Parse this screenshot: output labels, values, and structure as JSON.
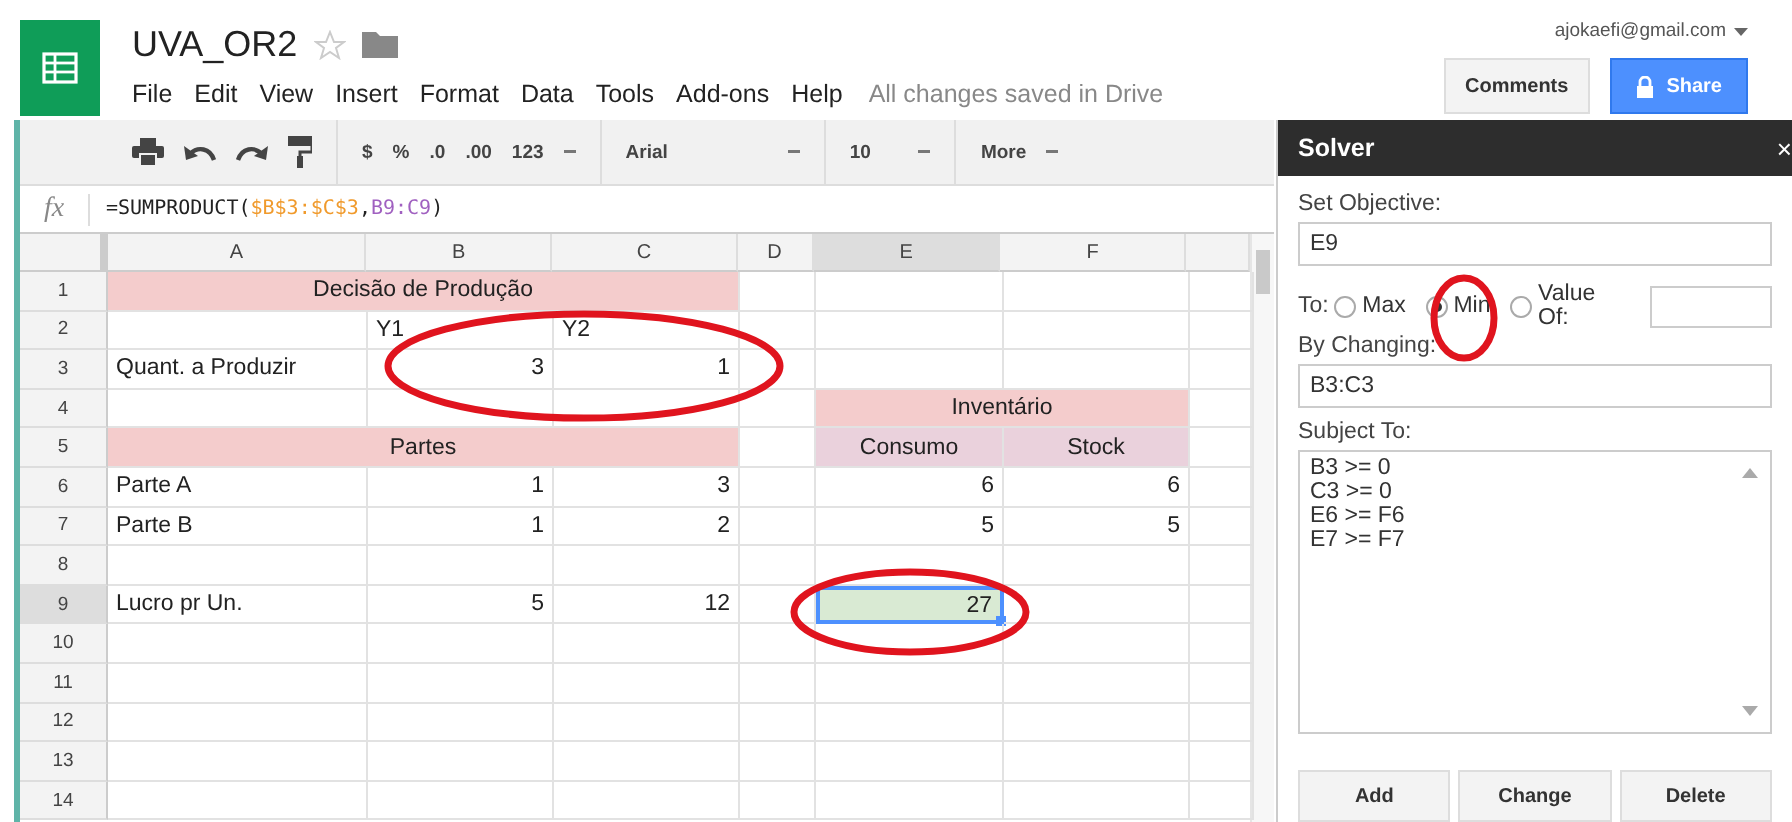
{
  "document": {
    "title": "UVA_OR2",
    "status": "All changes saved in Drive"
  },
  "menu": [
    "File",
    "Edit",
    "View",
    "Insert",
    "Format",
    "Data",
    "Tools",
    "Add-ons",
    "Help"
  ],
  "account": {
    "email": "ajokaefi@gmail.com",
    "buttons": [
      "Comments",
      "Share"
    ]
  },
  "toolbar": {
    "format_buttons": [
      "$",
      "%",
      ".0",
      ".00",
      "123"
    ],
    "font": "Arial",
    "font_size": "10",
    "more": "More"
  },
  "formula_bar": {
    "icon": "fx",
    "parts": [
      {
        "text": "=SUMPRODUCT(",
        "kind": "plain"
      },
      {
        "text": "$B$3:$C$3",
        "kind": "ref1"
      },
      {
        "text": ",",
        "kind": "plain"
      },
      {
        "text": "B9:C9",
        "kind": "ref2"
      },
      {
        "text": ")",
        "kind": "plain"
      }
    ]
  },
  "columns": [
    {
      "label": "A",
      "selected": false
    },
    {
      "label": "B",
      "selected": false
    },
    {
      "label": "C",
      "selected": false
    },
    {
      "label": "D",
      "selected": false
    },
    {
      "label": "E",
      "selected": true
    },
    {
      "label": "F",
      "selected": false
    }
  ],
  "rows": [
    {
      "number": "1",
      "selected": false,
      "cells": [
        {
          "text": "Decisão de Produção",
          "kind": "band",
          "selected": false
        },
        {},
        {},
        {},
        {}
      ]
    },
    {
      "number": "2",
      "selected": false,
      "cells": [
        {},
        {
          "text": "Y1",
          "kind": "text",
          "selected": false
        },
        {
          "text": "Y2",
          "kind": "text",
          "selected": false
        },
        {},
        {},
        {},
        {}
      ]
    },
    {
      "number": "3",
      "selected": false,
      "cells": [
        {
          "text": "Quant. a Produzir",
          "kind": "text",
          "selected": false
        },
        {
          "text": "3",
          "kind": "number",
          "selected": false
        },
        {
          "text": "1",
          "kind": "number",
          "selected": false
        },
        {},
        {},
        {},
        {}
      ]
    },
    {
      "number": "4",
      "selected": false,
      "cells": [
        {},
        {},
        {},
        {},
        {
          "text": "Inventário",
          "kind": "band",
          "selected": false
        },
        {}
      ]
    },
    {
      "number": "5",
      "selected": false,
      "cells": [
        {
          "text": "Partes",
          "kind": "band",
          "selected": false
        },
        {},
        {
          "text": "Consumo",
          "kind": "subband",
          "selected": false
        },
        {
          "text": "Stock",
          "kind": "subband",
          "selected": false
        },
        {}
      ]
    },
    {
      "number": "6",
      "selected": false,
      "cells": [
        {
          "text": "Parte A",
          "kind": "text",
          "selected": false
        },
        {
          "text": "1",
          "kind": "number",
          "selected": false
        },
        {
          "text": "3",
          "kind": "number",
          "selected": false
        },
        {},
        {
          "text": "6",
          "kind": "number",
          "selected": false
        },
        {
          "text": "6",
          "kind": "number",
          "selected": false
        },
        {}
      ]
    },
    {
      "number": "7",
      "selected": false,
      "cells": [
        {
          "text": "Parte B",
          "kind": "text",
          "selected": false
        },
        {
          "text": "1",
          "kind": "number",
          "selected": false
        },
        {
          "text": "2",
          "kind": "number",
          "selected": false
        },
        {},
        {
          "text": "5",
          "kind": "number",
          "selected": false
        },
        {
          "text": "5",
          "kind": "number",
          "selected": false
        },
        {}
      ]
    },
    {
      "number": "8",
      "selected": false
    },
    {
      "number": "9",
      "selected": true,
      "cells": [
        {
          "text": "Lucro pr Un.",
          "kind": "text",
          "selected": false
        },
        {
          "text": "5",
          "kind": "number",
          "selected": false
        },
        {
          "text": "12",
          "kind": "number",
          "selected": false
        },
        {},
        {
          "text": "27",
          "kind": "number",
          "selected": true
        },
        {},
        {}
      ]
    },
    {
      "number": "10",
      "selected": false
    },
    {
      "number": "11",
      "selected": false
    },
    {
      "number": "12",
      "selected": false
    },
    {
      "number": "13",
      "selected": false
    },
    {
      "number": "14",
      "selected": false
    }
  ],
  "solver": {
    "title": "Solver",
    "close": "×",
    "objective_label": "Set Objective:",
    "objective": "E9",
    "to_label": "To:",
    "options": [
      {
        "label": "Max",
        "selected": false
      },
      {
        "label": "Min",
        "selected": true
      },
      {
        "label": "Value Of:",
        "selected": false
      }
    ],
    "changing_label": "By Changing:",
    "changing": "B3:C3",
    "subject_label": "Subject To:",
    "constraints": [
      "B3 >= 0",
      "C3 >= 0",
      "E6 >= F6",
      "E7 >= F7"
    ],
    "buttons": [
      "Add",
      "Change",
      "Delete"
    ]
  }
}
